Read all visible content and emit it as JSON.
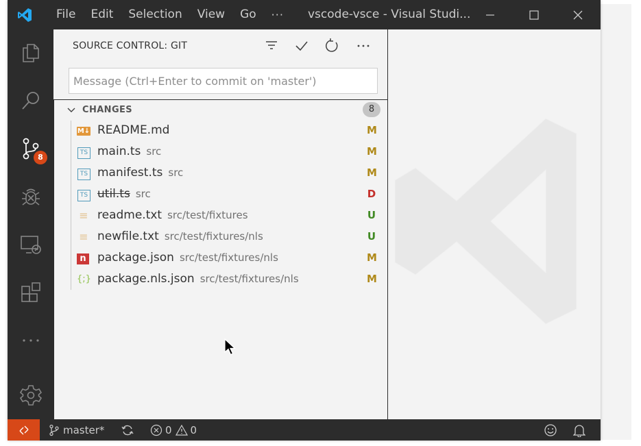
{
  "titlebar": {
    "menu": [
      "File",
      "Edit",
      "Selection",
      "View",
      "Go",
      "···"
    ],
    "title": "vscode-vsce - Visual Studi..."
  },
  "activity": {
    "scm_badge": "8"
  },
  "sidebar": {
    "title": "SOURCE CONTROL: GIT",
    "commit_placeholder": "Message (Ctrl+Enter to commit on 'master')",
    "changes_label": "CHANGES",
    "changes_count": "8",
    "files": [
      {
        "name": "README.md",
        "path": "",
        "status": "M",
        "icon": "markdown-icon",
        "glyph": "M↓",
        "deleted": false
      },
      {
        "name": "main.ts",
        "path": "src",
        "status": "M",
        "icon": "typescript-icon",
        "glyph": "TS",
        "deleted": false
      },
      {
        "name": "manifest.ts",
        "path": "src",
        "status": "M",
        "icon": "typescript-icon",
        "glyph": "TS",
        "deleted": false
      },
      {
        "name": "util.ts",
        "path": "src",
        "status": "D",
        "icon": "typescript-icon",
        "glyph": "TS",
        "deleted": true
      },
      {
        "name": "readme.txt",
        "path": "src/test/fixtures",
        "status": "U",
        "icon": "text-file-icon",
        "glyph": "≡",
        "deleted": false
      },
      {
        "name": "newfile.txt",
        "path": "src/test/fixtures/nls",
        "status": "U",
        "icon": "text-file-icon",
        "glyph": "≡",
        "deleted": false
      },
      {
        "name": "package.json",
        "path": "src/test/fixtures/nls",
        "status": "M",
        "icon": "npm-icon",
        "glyph": "n",
        "deleted": false
      },
      {
        "name": "package.nls.json",
        "path": "src/test/fixtures/nls",
        "status": "M",
        "icon": "json-icon",
        "glyph": "{;}",
        "deleted": false
      }
    ]
  },
  "statusbar": {
    "branch": "master*",
    "errors": "0",
    "warnings": "0"
  },
  "colors": {
    "modified": "#b08a1a",
    "deleted": "#c4302b",
    "untracked": "#418a24",
    "remote": "#d74818",
    "chrome": "#2c2c2c"
  }
}
